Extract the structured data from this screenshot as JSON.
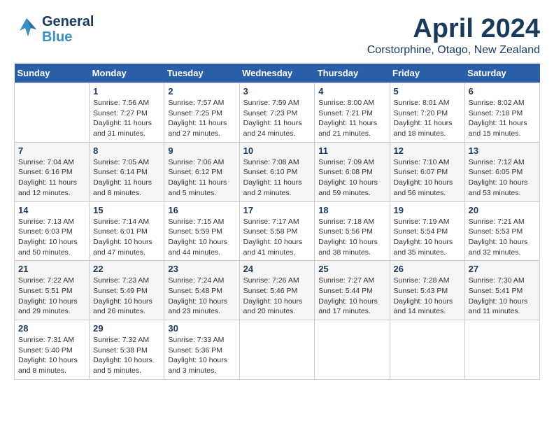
{
  "header": {
    "logo_general": "General",
    "logo_blue": "Blue",
    "month_title": "April 2024",
    "location": "Corstorphine, Otago, New Zealand"
  },
  "days_of_week": [
    "Sunday",
    "Monday",
    "Tuesday",
    "Wednesday",
    "Thursday",
    "Friday",
    "Saturday"
  ],
  "weeks": [
    [
      {
        "day": "",
        "info": ""
      },
      {
        "day": "1",
        "info": "Sunrise: 7:56 AM\nSunset: 7:27 PM\nDaylight: 11 hours\nand 31 minutes."
      },
      {
        "day": "2",
        "info": "Sunrise: 7:57 AM\nSunset: 7:25 PM\nDaylight: 11 hours\nand 27 minutes."
      },
      {
        "day": "3",
        "info": "Sunrise: 7:59 AM\nSunset: 7:23 PM\nDaylight: 11 hours\nand 24 minutes."
      },
      {
        "day": "4",
        "info": "Sunrise: 8:00 AM\nSunset: 7:21 PM\nDaylight: 11 hours\nand 21 minutes."
      },
      {
        "day": "5",
        "info": "Sunrise: 8:01 AM\nSunset: 7:20 PM\nDaylight: 11 hours\nand 18 minutes."
      },
      {
        "day": "6",
        "info": "Sunrise: 8:02 AM\nSunset: 7:18 PM\nDaylight: 11 hours\nand 15 minutes."
      }
    ],
    [
      {
        "day": "7",
        "info": "Sunrise: 7:04 AM\nSunset: 6:16 PM\nDaylight: 11 hours\nand 12 minutes."
      },
      {
        "day": "8",
        "info": "Sunrise: 7:05 AM\nSunset: 6:14 PM\nDaylight: 11 hours\nand 8 minutes."
      },
      {
        "day": "9",
        "info": "Sunrise: 7:06 AM\nSunset: 6:12 PM\nDaylight: 11 hours\nand 5 minutes."
      },
      {
        "day": "10",
        "info": "Sunrise: 7:08 AM\nSunset: 6:10 PM\nDaylight: 11 hours\nand 2 minutes."
      },
      {
        "day": "11",
        "info": "Sunrise: 7:09 AM\nSunset: 6:08 PM\nDaylight: 10 hours\nand 59 minutes."
      },
      {
        "day": "12",
        "info": "Sunrise: 7:10 AM\nSunset: 6:07 PM\nDaylight: 10 hours\nand 56 minutes."
      },
      {
        "day": "13",
        "info": "Sunrise: 7:12 AM\nSunset: 6:05 PM\nDaylight: 10 hours\nand 53 minutes."
      }
    ],
    [
      {
        "day": "14",
        "info": "Sunrise: 7:13 AM\nSunset: 6:03 PM\nDaylight: 10 hours\nand 50 minutes."
      },
      {
        "day": "15",
        "info": "Sunrise: 7:14 AM\nSunset: 6:01 PM\nDaylight: 10 hours\nand 47 minutes."
      },
      {
        "day": "16",
        "info": "Sunrise: 7:15 AM\nSunset: 5:59 PM\nDaylight: 10 hours\nand 44 minutes."
      },
      {
        "day": "17",
        "info": "Sunrise: 7:17 AM\nSunset: 5:58 PM\nDaylight: 10 hours\nand 41 minutes."
      },
      {
        "day": "18",
        "info": "Sunrise: 7:18 AM\nSunset: 5:56 PM\nDaylight: 10 hours\nand 38 minutes."
      },
      {
        "day": "19",
        "info": "Sunrise: 7:19 AM\nSunset: 5:54 PM\nDaylight: 10 hours\nand 35 minutes."
      },
      {
        "day": "20",
        "info": "Sunrise: 7:21 AM\nSunset: 5:53 PM\nDaylight: 10 hours\nand 32 minutes."
      }
    ],
    [
      {
        "day": "21",
        "info": "Sunrise: 7:22 AM\nSunset: 5:51 PM\nDaylight: 10 hours\nand 29 minutes."
      },
      {
        "day": "22",
        "info": "Sunrise: 7:23 AM\nSunset: 5:49 PM\nDaylight: 10 hours\nand 26 minutes."
      },
      {
        "day": "23",
        "info": "Sunrise: 7:24 AM\nSunset: 5:48 PM\nDaylight: 10 hours\nand 23 minutes."
      },
      {
        "day": "24",
        "info": "Sunrise: 7:26 AM\nSunset: 5:46 PM\nDaylight: 10 hours\nand 20 minutes."
      },
      {
        "day": "25",
        "info": "Sunrise: 7:27 AM\nSunset: 5:44 PM\nDaylight: 10 hours\nand 17 minutes."
      },
      {
        "day": "26",
        "info": "Sunrise: 7:28 AM\nSunset: 5:43 PM\nDaylight: 10 hours\nand 14 minutes."
      },
      {
        "day": "27",
        "info": "Sunrise: 7:30 AM\nSunset: 5:41 PM\nDaylight: 10 hours\nand 11 minutes."
      }
    ],
    [
      {
        "day": "28",
        "info": "Sunrise: 7:31 AM\nSunset: 5:40 PM\nDaylight: 10 hours\nand 8 minutes."
      },
      {
        "day": "29",
        "info": "Sunrise: 7:32 AM\nSunset: 5:38 PM\nDaylight: 10 hours\nand 5 minutes."
      },
      {
        "day": "30",
        "info": "Sunrise: 7:33 AM\nSunset: 5:36 PM\nDaylight: 10 hours\nand 3 minutes."
      },
      {
        "day": "",
        "info": ""
      },
      {
        "day": "",
        "info": ""
      },
      {
        "day": "",
        "info": ""
      },
      {
        "day": "",
        "info": ""
      }
    ]
  ]
}
